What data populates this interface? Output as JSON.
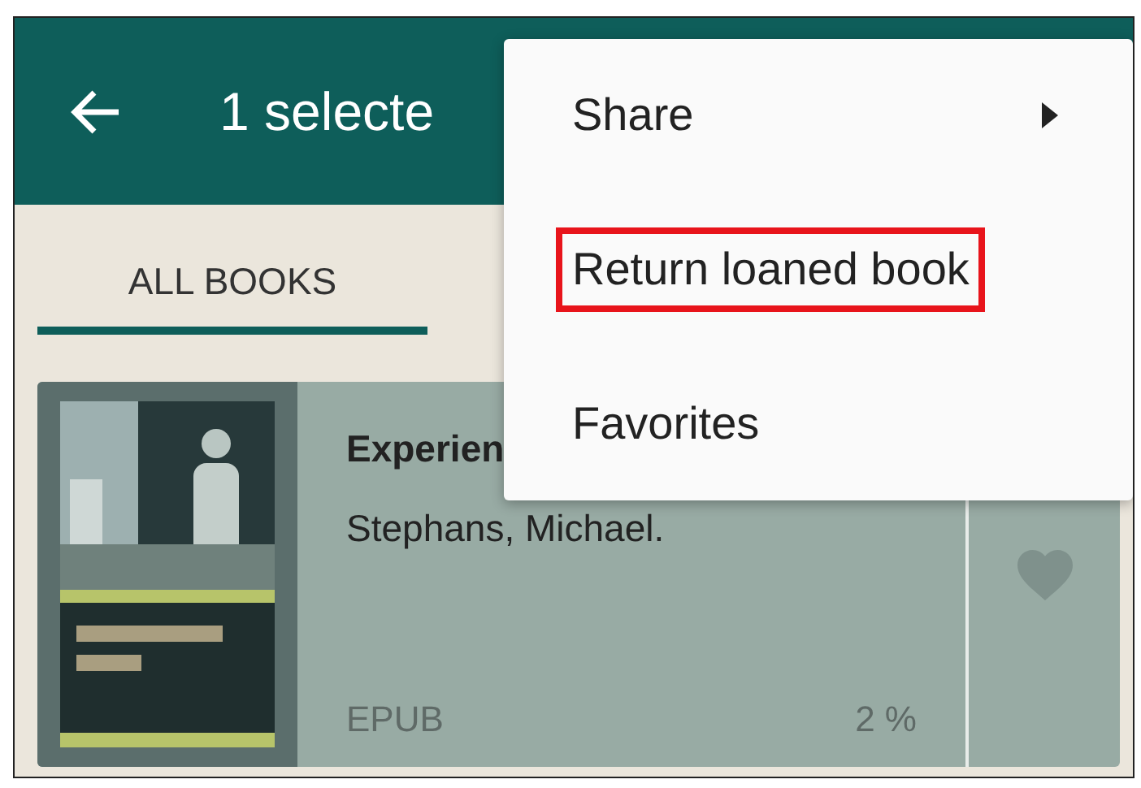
{
  "toolbar": {
    "title": "1 selecte"
  },
  "tabs": [
    {
      "label": "ALL BOOKS",
      "selected": true
    }
  ],
  "book": {
    "title": "Experien",
    "author": "Stephans, Michael.",
    "format": "EPUB",
    "progress": "2 %",
    "selected": true,
    "favorite": false
  },
  "menu": {
    "items": [
      {
        "label": "Share",
        "submenu": true,
        "highlighted": false
      },
      {
        "label": "Return loaned book",
        "submenu": false,
        "highlighted": true
      },
      {
        "label": "Favorites",
        "submenu": false,
        "highlighted": false
      }
    ]
  }
}
